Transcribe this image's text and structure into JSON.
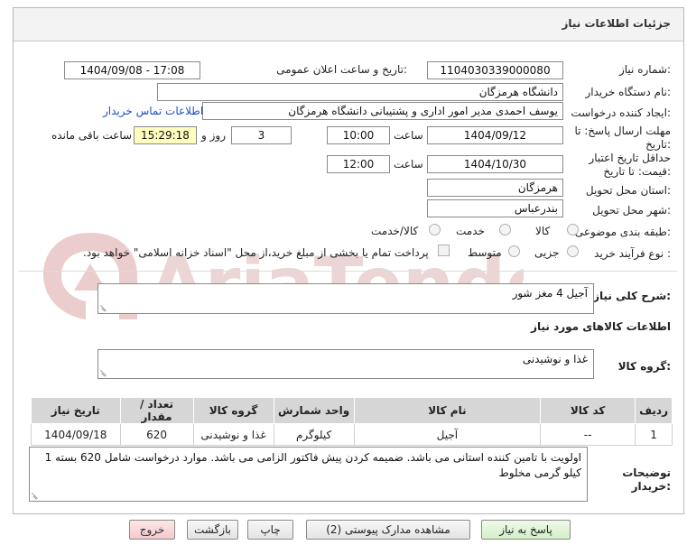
{
  "header": {
    "title": "جزئیات اطلاعات نیاز"
  },
  "fields": {
    "need_number_label": "شماره نیاز:",
    "need_number": "1104030339000080",
    "announce_label": "تاریخ و ساعت اعلان عمومی:",
    "announce_value": "1404/09/08 - 17:08",
    "buyer_org_label": "نام دستگاه خریدار:",
    "buyer_org": "دانشگاه هرمزگان",
    "requester_label": "ایجاد کننده درخواست:",
    "requester": "یوسف احمدی مدیر امور اداری و پشتیبانی دانشگاه هرمزگان",
    "contact_link": "اطلاعات تماس خریدار",
    "deadline_label_1": "مهلت ارسال پاسخ: تا",
    "deadline_label_2": "تاریخ:",
    "deadline_date": "1404/09/12",
    "time_label": "ساعت",
    "deadline_time": "10:00",
    "days": "3",
    "days_label": "روز و",
    "remaining_time": "15:29:18",
    "remaining_label": "ساعت باقی مانده",
    "validity_label_1": "حداقل تاریخ اعتبار",
    "validity_label_2": "قیمت: تا تاریخ:",
    "validity_date": "1404/10/30",
    "validity_time_label": "ساعت",
    "validity_time": "12:00",
    "province_label": "استان محل تحویل:",
    "province": "هرمزگان",
    "city_label": "شهر محل تحویل:",
    "city": "بندرعباس",
    "category_label": "طبقه بندی موضوعی:",
    "category_options": [
      "کالا",
      "خدمت",
      "کالا/خدمت"
    ],
    "process_label": "نوع فرآیند خرید :",
    "process_options": [
      "جزیی",
      "متوسط"
    ],
    "payment_note": "پرداخت تمام یا بخشی از مبلغ خرید،از محل \"اسناد خزانه اسلامی\" خواهد بود."
  },
  "summary": {
    "label": "شرح کلی نیاز:",
    "value": "آجیل 4 مغز شور"
  },
  "goods": {
    "section_title": "اطلاعات کالاهای مورد نیاز",
    "group_label": "گروه کالا:",
    "group_value": "غذا و نوشیدنی",
    "table": {
      "headers": [
        "ردیف",
        "کد کالا",
        "نام کالا",
        "واحد شمارش",
        "گروه کالا",
        "تعداد / مقدار",
        "تاریخ نیاز"
      ],
      "rows": [
        [
          "1",
          "--",
          "آجیل",
          "کیلوگرم",
          "غذا و نوشیدنی",
          "620",
          "1404/09/18"
        ]
      ]
    }
  },
  "notes": {
    "label_1": "توضیحات",
    "label_2": "خریدار:",
    "value": "اولویت با تامین کننده استانی می باشد. ضمیمه کردن پیش فاکتور الزامی می باشد. موارد درخواست شامل 620 بسته 1 کیلو گرمی مخلوط"
  },
  "buttons": {
    "reply": "پاسخ به نیاز",
    "attachments": "مشاهده مدارک پیوستی (2)",
    "print": "چاپ",
    "back": "بازگشت",
    "exit": "خروج"
  },
  "watermark": {
    "text": "AriaTender.net"
  },
  "colors": {
    "highlight": "#ffffbf",
    "link": "#1a4fc4",
    "header_bg": "#d6d6d6",
    "watermark": "#e9c9c9"
  }
}
